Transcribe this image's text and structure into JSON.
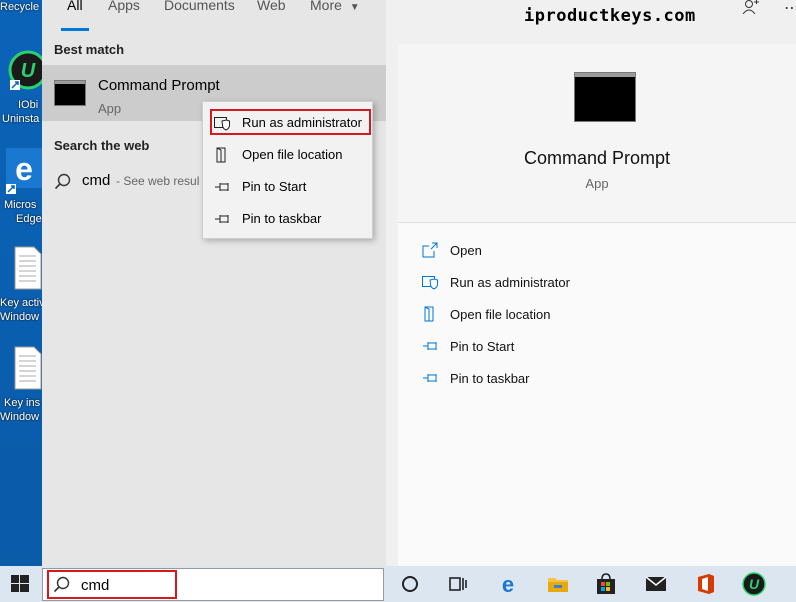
{
  "desktop": {
    "icons": [
      {
        "label": "Recycle",
        "name": "recycle-bin-icon"
      },
      {
        "label1": "IObi",
        "label2": "Uninsta",
        "name": "iobit-uninstaller-icon"
      },
      {
        "label1": "Micros",
        "label2": "Edge",
        "name": "microsoft-edge-icon"
      },
      {
        "label1": "Key activ",
        "label2": "Window",
        "name": "text-document-icon"
      },
      {
        "label1": "Key ins",
        "label2": "Window",
        "name": "text-document-icon"
      }
    ]
  },
  "tabs": [
    {
      "label": "All",
      "active": true
    },
    {
      "label": "Apps"
    },
    {
      "label": "Documents"
    },
    {
      "label": "Web"
    },
    {
      "label": "More"
    }
  ],
  "watermark": "iproductkeys.com",
  "best_match": {
    "heading": "Best match",
    "title": "Command Prompt",
    "subtitle": "App"
  },
  "search_web": {
    "heading": "Search the web",
    "query": "cmd",
    "hint": "- See web resul"
  },
  "context_menu": {
    "items": [
      {
        "label": "Run as administrator",
        "icon": "shield-window-icon",
        "highlighted": true
      },
      {
        "label": "Open file location",
        "icon": "file-location-icon"
      },
      {
        "label": "Pin to Start",
        "icon": "pin-icon"
      },
      {
        "label": "Pin to taskbar",
        "icon": "pin-icon"
      }
    ]
  },
  "details": {
    "title": "Command Prompt",
    "subtitle": "App",
    "actions": [
      {
        "label": "Open",
        "icon": "open-icon"
      },
      {
        "label": "Run as administrator",
        "icon": "shield-window-icon"
      },
      {
        "label": "Open file location",
        "icon": "file-location-icon"
      },
      {
        "label": "Pin to Start",
        "icon": "pin-icon"
      },
      {
        "label": "Pin to taskbar",
        "icon": "pin-icon"
      }
    ]
  },
  "taskbar": {
    "search_value": "cmd",
    "apps": [
      "cortana-icon",
      "task-view-icon",
      "edge-icon",
      "file-explorer-icon",
      "store-icon",
      "mail-icon",
      "office-icon",
      "iobit-icon"
    ]
  },
  "colors": {
    "accent": "#0078d7",
    "highlight_red": "#d6181f"
  }
}
